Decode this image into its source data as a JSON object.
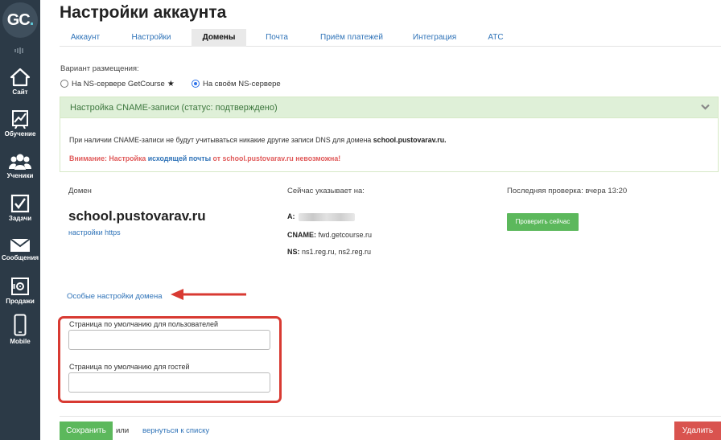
{
  "sidebar": {
    "logo": "GC",
    "logo_dot": ".",
    "items": [
      {
        "label": "Сайт",
        "icon": "home-icon"
      },
      {
        "label": "Обучение",
        "icon": "chart-icon"
      },
      {
        "label": "Ученики",
        "icon": "users-icon"
      },
      {
        "label": "Задачи",
        "icon": "checkbox-icon"
      },
      {
        "label": "Сообщения",
        "icon": "envelope-icon"
      },
      {
        "label": "Продажи",
        "icon": "safe-icon"
      },
      {
        "label": "Mobile",
        "icon": "phone-icon"
      }
    ]
  },
  "page": {
    "title": "Настройки аккаунта"
  },
  "tabs": [
    {
      "label": "Аккаунт"
    },
    {
      "label": "Настройки"
    },
    {
      "label": "Домены"
    },
    {
      "label": "Почта"
    },
    {
      "label": "Приём платежей"
    },
    {
      "label": "Интеграция"
    },
    {
      "label": "АТС"
    }
  ],
  "placement": {
    "label": "Вариант размещения:",
    "option_getcourse": "На NS-сервере GetCourse",
    "option_own": "На своём NS-сервере",
    "selected": "На своём NS-сервере"
  },
  "cname_panel": {
    "header": "Настройка CNAME-записи (статус: подтверждено)",
    "info_prefix": "При наличии CNAME-записи не будут учитываться никакие другие записи DNS для домена ",
    "info_domain": "school.pustovarav.ru.",
    "warn_prefix": "Внимание: Настройка ",
    "warn_link": "исходящей почты",
    "warn_suffix": " от school.pustovarav.ru невозможна!"
  },
  "domain_section": {
    "domain_label": "Домен",
    "domain_name": "school.pustovarav.ru",
    "https_link": "настройки https",
    "points_label": "Сейчас указывает на:",
    "a_label": "A:",
    "cname_label": "CNAME:",
    "cname_value": "fwd.getcourse.ru",
    "ns_label": "NS:",
    "ns_value": "ns1.reg.ru, ns2.reg.ru",
    "last_check_label": "Последняя проверка: вчера 13:20",
    "check_button": "Проверить сейчас"
  },
  "special_settings": {
    "link": "Особые настройки домена",
    "users_page_label": "Страница по умолчанию для пользователей",
    "users_page_value": "",
    "guests_page_label": "Страница по умолчанию для гостей",
    "guests_page_value": ""
  },
  "footer": {
    "save": "Сохранить",
    "or": "или",
    "back_link": "вернуться к списку",
    "delete": "Удалить"
  },
  "colors": {
    "sidebar_bg": "#2c3a47",
    "link": "#2f73b8",
    "success": "#5cb85c",
    "danger": "#d9534f",
    "annotation_red": "#d83a32"
  }
}
